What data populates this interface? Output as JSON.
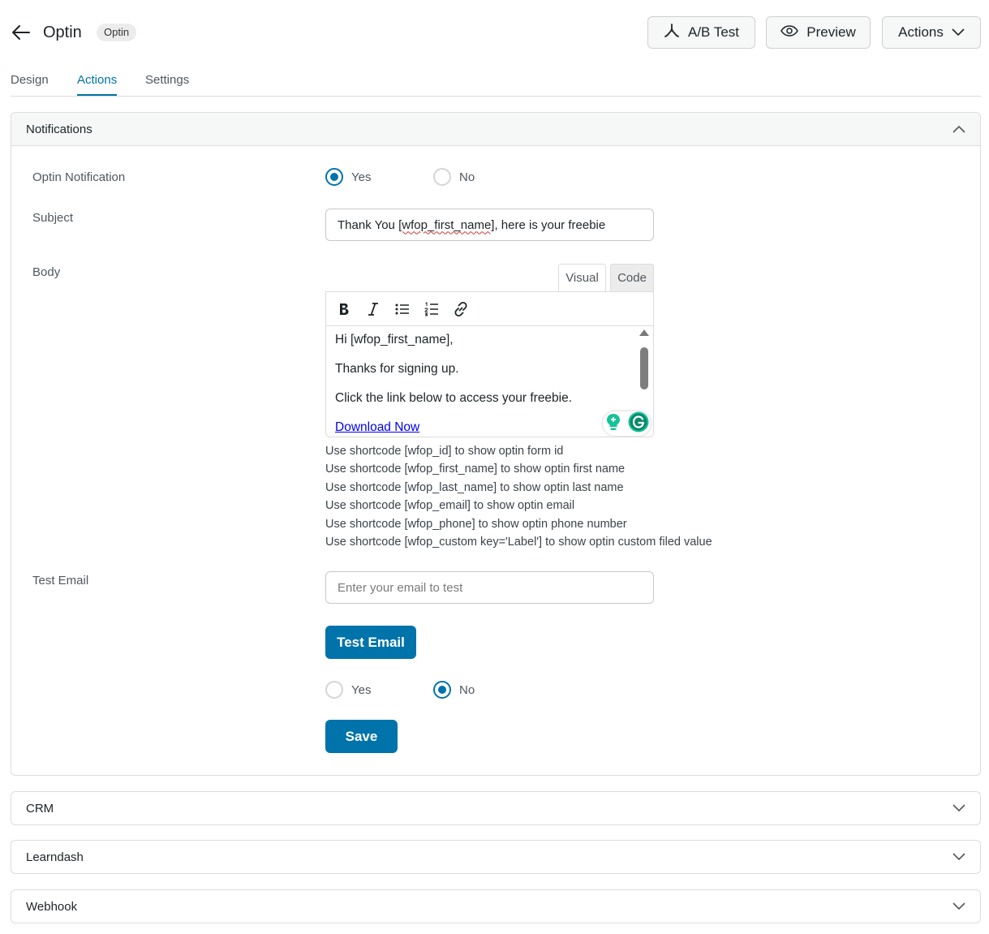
{
  "header": {
    "title": "Optin",
    "badge": "Optin",
    "ab_test_label": "A/B Test",
    "preview_label": "Preview",
    "actions_label": "Actions"
  },
  "tabs": [
    {
      "label": "Design",
      "active": false
    },
    {
      "label": "Actions",
      "active": true
    },
    {
      "label": "Settings",
      "active": false
    }
  ],
  "notifications": {
    "title": "Notifications",
    "optin_notification": {
      "label": "Optin Notification",
      "yes_label": "Yes",
      "no_label": "No",
      "selected": "Yes"
    },
    "subject": {
      "label": "Subject",
      "value_prefix": "Thank You ",
      "value_shortcode": "[wfop_first_name]",
      "value_suffix": ", here is your freebie"
    },
    "body": {
      "label": "Body",
      "visual_tab": "Visual",
      "code_tab": "Code",
      "lines": [
        "Hi [wfop_first_name],",
        "Thanks for signing up.",
        "Click the link below to access your freebie."
      ],
      "link_text": "Download Now"
    },
    "help_lines": [
      "Use shortcode [wfop_id] to show optin form id",
      "Use shortcode [wfop_first_name] to show optin first name",
      "Use shortcode [wfop_last_name] to show optin last name",
      "Use shortcode [wfop_email] to show optin email",
      "Use shortcode [wfop_phone] to show optin phone number",
      "Use shortcode [wfop_custom key='Label'] to show optin custom filed value"
    ],
    "test_email": {
      "label": "Test Email",
      "placeholder": "Enter your email to test",
      "button_label": "Test Email",
      "yes_label": "Yes",
      "no_label": "No",
      "selected": "No"
    },
    "save_label": "Save"
  },
  "sections": {
    "crm": "CRM",
    "learndash": "Learndash",
    "webhook": "Webhook"
  },
  "colors": {
    "accent": "#0073aa",
    "border": "#dcdcde",
    "grammarly_green": "#15c39a"
  }
}
